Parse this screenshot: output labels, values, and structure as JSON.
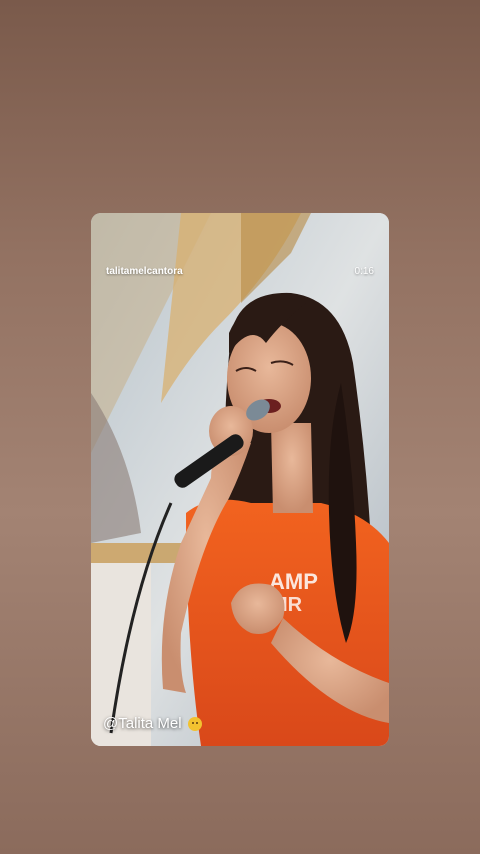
{
  "story": {
    "username": "talitamelcantora",
    "duration": "0:16",
    "caption": "@Talita Mel",
    "caption_emoji": "smiling-face-emoji"
  },
  "colors": {
    "background": "#937262",
    "shirt": "#e8541c",
    "hair": "#2a1a14"
  }
}
